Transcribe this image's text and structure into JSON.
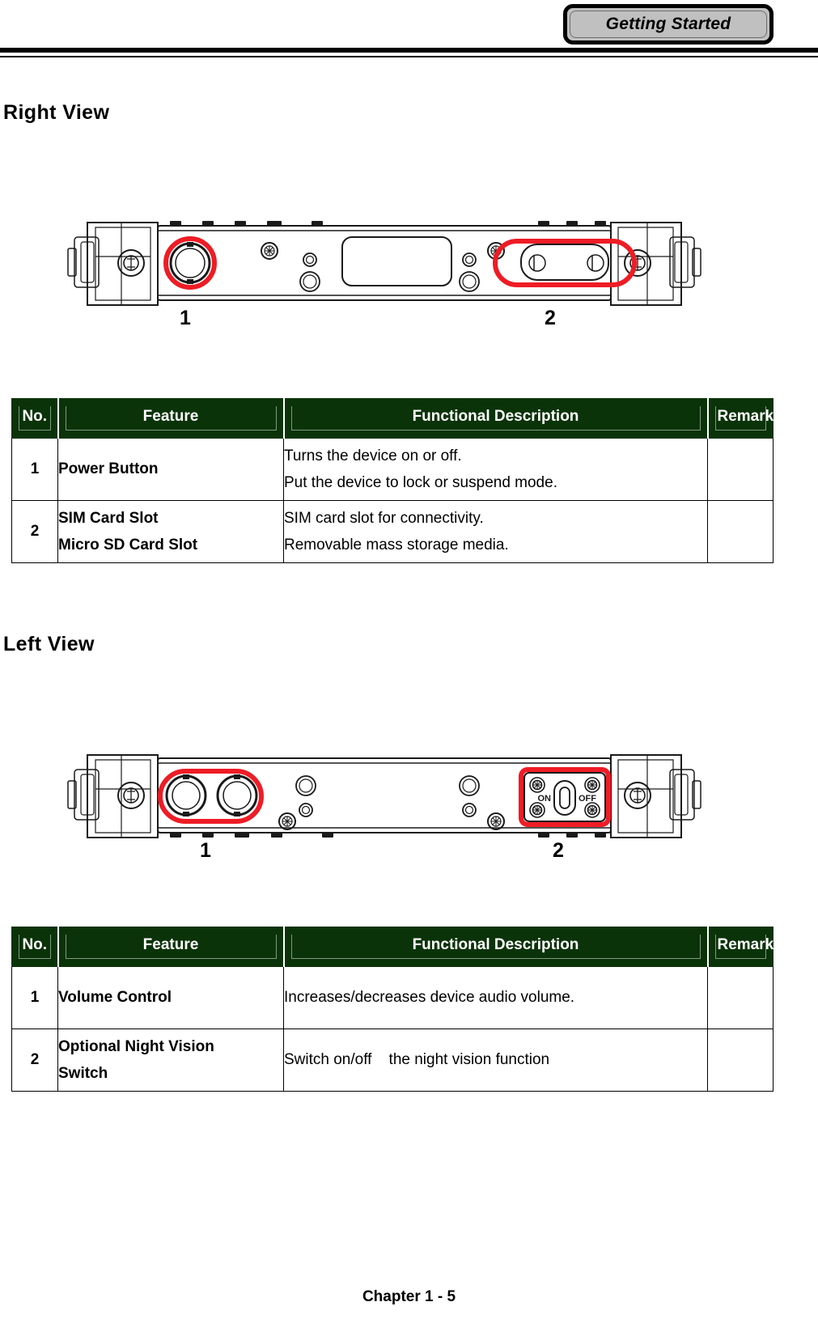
{
  "header": {
    "tab_label": "Getting Started"
  },
  "sections": [
    {
      "heading": "Right View",
      "callouts": [
        {
          "label": "1"
        },
        {
          "label": "2"
        }
      ],
      "table": {
        "columns": [
          "No.",
          "Feature",
          "Functional Description",
          "Remark"
        ],
        "rows": [
          {
            "no": "1",
            "feature_lines": [
              "Power Button"
            ],
            "desc_lines": [
              "Turns the device on or off.",
              "Put the device to lock or suspend mode."
            ],
            "remark": ""
          },
          {
            "no": "2",
            "feature_lines": [
              "SIM Card Slot",
              "Micro SD Card Slot"
            ],
            "desc_lines": [
              "SIM card slot for connectivity.",
              "Removable mass storage media."
            ],
            "remark": ""
          }
        ]
      }
    },
    {
      "heading": "Left View",
      "callouts": [
        {
          "label": "1"
        },
        {
          "label": "2"
        }
      ],
      "switch_labels": {
        "on": "ON",
        "off": "OFF"
      },
      "table": {
        "columns": [
          "No.",
          "Feature",
          "Functional Description",
          "Remark"
        ],
        "rows": [
          {
            "no": "1",
            "feature_lines": [
              "Volume Control"
            ],
            "desc_lines": [
              "Increases/decreases device audio volume."
            ],
            "remark": ""
          },
          {
            "no": "2",
            "feature_lines": [
              "Optional Night Vision",
              "Switch"
            ],
            "desc_lines": [
              "Switch on/off    the night vision function"
            ],
            "remark": ""
          }
        ]
      }
    }
  ],
  "footer": {
    "text": "Chapter 1 - 5"
  },
  "colors": {
    "table_header_bg": "#0b3309",
    "highlight_red": "#ee1c25",
    "tab_bg": "#c0c0c0"
  }
}
